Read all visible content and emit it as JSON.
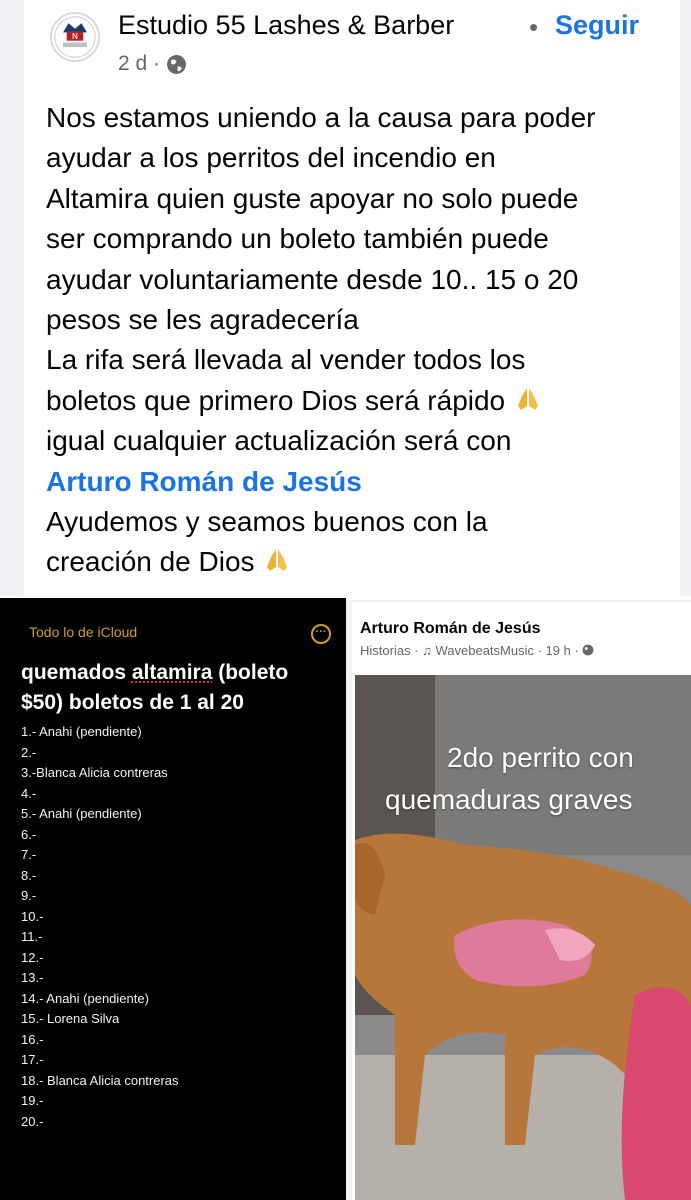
{
  "post": {
    "page_name": "Estudio 55 Lashes & Barber",
    "separator": "•",
    "follow_label": "Seguir",
    "time": "2 d ·",
    "privacy_icon": "globe-icon",
    "lines": [
      "Nos estamos uniendo a la causa para poder",
      "ayudar a los perritos del incendio en",
      "Altamira quien guste apoyar no solo puede",
      "ser comprando un boleto también puede",
      "ayudar voluntariamente desde 10.. 15 o 20",
      "pesos  se les agradecería",
      "La rifa será llevada al vender todos los",
      "boletos que primero Dios será rápido"
    ],
    "line_9": "igual cualquier actualización será con",
    "mention": "Arturo Román de Jesús",
    "line_11": "Ayudemos y seamos buenos con la",
    "line_12": "creación de Dios"
  },
  "notes_image": {
    "top_label": "Todo lo de iCloud",
    "title_before": "quemados ",
    "title_underlined": "altamira",
    "title_after": " (boleto",
    "title_line2": "$50) boletos de 1 al 20",
    "items": [
      "1.- Anahi (pendiente)",
      "2.-",
      "3.-Blanca Alicia contreras",
      "4.-",
      "5.- Anahi (pendiente)",
      "6.-",
      "7.-",
      "8.-",
      "9.-",
      "10.-",
      "11.-",
      "12.-",
      "13.-",
      "14.- Anahi (pendiente)",
      "15.- Lorena Silva",
      "16.-",
      "17.-",
      "18.- Blanca Alicia contreras",
      "19.-",
      "20.-"
    ]
  },
  "story_image": {
    "author": "Arturo Román de Jesús",
    "meta": "Historias · ♫ WavebeatsMusic · 19 h · ",
    "caption_line1": "2do perrito con",
    "caption_line2": "quemaduras graves"
  },
  "colors": {
    "link_blue": "#1b74e4",
    "notes_accent": "#d4a017"
  }
}
